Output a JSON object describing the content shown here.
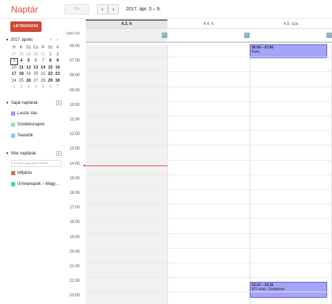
{
  "app": {
    "title": "Naptár"
  },
  "toolbar": {
    "today_label": "Ma",
    "prev_label": "‹",
    "next_label": "›",
    "date_range": "2017. ápr. 3 – 9."
  },
  "create_label": "LÉTREHOZÁS",
  "mini_calendar": {
    "month_label": "2017. április",
    "weekdays": [
      "H",
      "K",
      "Sz",
      "Cs",
      "P",
      "Sz",
      "V"
    ],
    "weeks": [
      [
        "27",
        "28",
        "29",
        "30",
        "31",
        "1",
        "2"
      ],
      [
        "3",
        "4",
        "5",
        "6",
        "7",
        "8",
        "9"
      ],
      [
        "10",
        "11",
        "12",
        "13",
        "14",
        "15",
        "16"
      ],
      [
        "17",
        "18",
        "19",
        "20",
        "21",
        "22",
        "23"
      ],
      [
        "24",
        "25",
        "26",
        "27",
        "28",
        "29",
        "30"
      ],
      [
        "1",
        "2",
        "3",
        "4",
        "5",
        "6",
        "7"
      ]
    ]
  },
  "my_calendars": {
    "heading": "Saját naptárak",
    "items": [
      {
        "label": "Laszlo Vas",
        "color": "#9a9cff"
      },
      {
        "label": "Születésnapok",
        "color": "#92e1c0"
      },
      {
        "label": "Teendők",
        "color": "#9fc6e7"
      }
    ]
  },
  "other_calendars": {
    "heading": "Más naptárak",
    "input_placeholder": "Ismerős naptárának felvétele",
    "items": [
      {
        "label": "Időjárás",
        "color": "#d06b64"
      },
      {
        "label": "Ünnepnapok – Magy…",
        "color": "#42d692"
      }
    ]
  },
  "grid": {
    "timezone": "GMT+02",
    "days": [
      "4.3. h",
      "4.4. k",
      "4.5. sze"
    ],
    "hours": [
      "06:00",
      "07:00",
      "08:00",
      "09:00",
      "10:00",
      "11:00",
      "12:00",
      "13:00",
      "14:00",
      "15:00",
      "16:00",
      "17:00",
      "18:00",
      "19:00",
      "20:00",
      "21:00",
      "22:00",
      "23:00"
    ]
  },
  "events": [
    {
      "time": "06:00 – 07:00",
      "title": "Kuka",
      "color": "#a4a4f8"
    },
    {
      "time": "22:10 – 23:15",
      "title": "RTL klub - Szulejmán",
      "color": "#a4a4f8"
    }
  ],
  "colors": {
    "accent": "#dd4b39",
    "create_button": "#d14836",
    "now_line": "#dd4b39"
  }
}
